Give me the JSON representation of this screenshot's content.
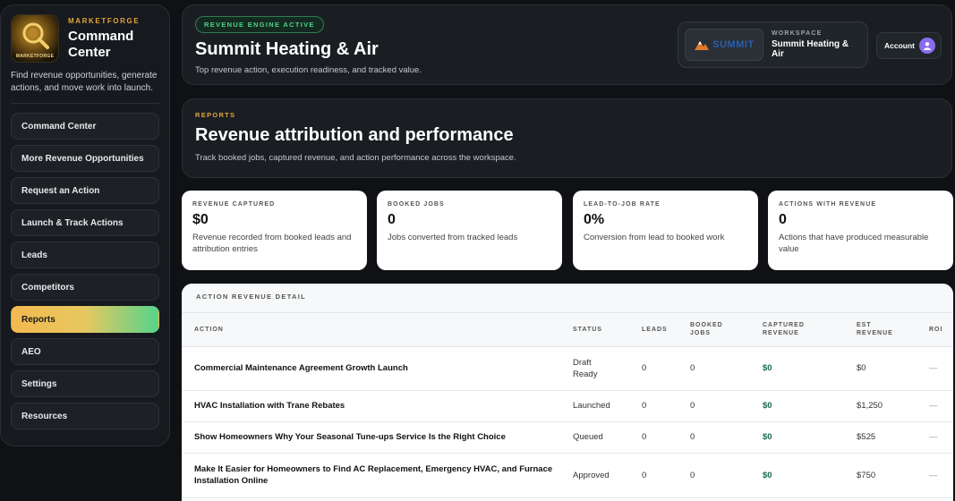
{
  "sidebar": {
    "logo_text": "MARKETFORGE",
    "kicker": "MARKETFORGE",
    "title_line1": "Command",
    "title_line2": "Center",
    "description": "Find revenue opportunities, generate actions, and move work into launch.",
    "items": [
      {
        "label": "Command Center",
        "active": false
      },
      {
        "label": "More Revenue Opportunities",
        "active": false
      },
      {
        "label": "Request an Action",
        "active": false
      },
      {
        "label": "Launch & Track Actions",
        "active": false
      },
      {
        "label": "Leads",
        "active": false
      },
      {
        "label": "Competitors",
        "active": false
      },
      {
        "label": "Reports",
        "active": true
      },
      {
        "label": "AEO",
        "active": false
      },
      {
        "label": "Settings",
        "active": false
      },
      {
        "label": "Resources",
        "active": false
      }
    ]
  },
  "header": {
    "pill": "REVENUE ENGINE ACTIVE",
    "title": "Summit Heating & Air",
    "subtitle": "Top revenue action, execution readiness, and tracked value.",
    "workspace_logo": "SUMMIT",
    "workspace_label": "WORKSPACE",
    "workspace_name": "Summit Heating & Air",
    "account_label": "Account"
  },
  "reports": {
    "kicker": "REPORTS",
    "title": "Revenue attribution and performance",
    "subtitle": "Track booked jobs, captured revenue, and action performance across the workspace."
  },
  "stats": [
    {
      "label": "REVENUE CAPTURED",
      "value": "$0",
      "desc": "Revenue recorded from booked leads and attribution entries"
    },
    {
      "label": "BOOKED JOBS",
      "value": "0",
      "desc": "Jobs converted from tracked leads"
    },
    {
      "label": "LEAD-TO-JOB RATE",
      "value": "0%",
      "desc": "Conversion from lead to booked work"
    },
    {
      "label": "ACTIONS WITH REVENUE",
      "value": "0",
      "desc": "Actions that have produced measurable value"
    }
  ],
  "table": {
    "title": "ACTION REVENUE DETAIL",
    "headers": {
      "action": "ACTION",
      "status": "STATUS",
      "leads": "LEADS",
      "booked_1": "BOOKED",
      "booked_2": "JOBS",
      "captured_1": "CAPTURED",
      "captured_2": "REVENUE",
      "est_1": "EST",
      "est_2": "REVENUE",
      "roi": "ROI"
    },
    "rows": [
      {
        "action": "Commercial Maintenance Agreement Growth Launch",
        "status": "Draft Ready",
        "leads": "0",
        "booked": "0",
        "captured": "$0",
        "est": "$0",
        "roi": "—"
      },
      {
        "action": "HVAC Installation with Trane Rebates",
        "status": "Launched",
        "leads": "0",
        "booked": "0",
        "captured": "$0",
        "est": "$1,250",
        "roi": "—"
      },
      {
        "action": "Show Homeowners Why Your Seasonal Tune-ups Service Is the Right Choice",
        "status": "Queued",
        "leads": "0",
        "booked": "0",
        "captured": "$0",
        "est": "$525",
        "roi": "—"
      },
      {
        "action": "Make It Easier for Homeowners to Find AC Replacement, Emergency HVAC, and Furnace Installation Online",
        "status": "Approved",
        "leads": "0",
        "booked": "0",
        "captured": "$0",
        "est": "$750",
        "roi": "—"
      }
    ]
  }
}
